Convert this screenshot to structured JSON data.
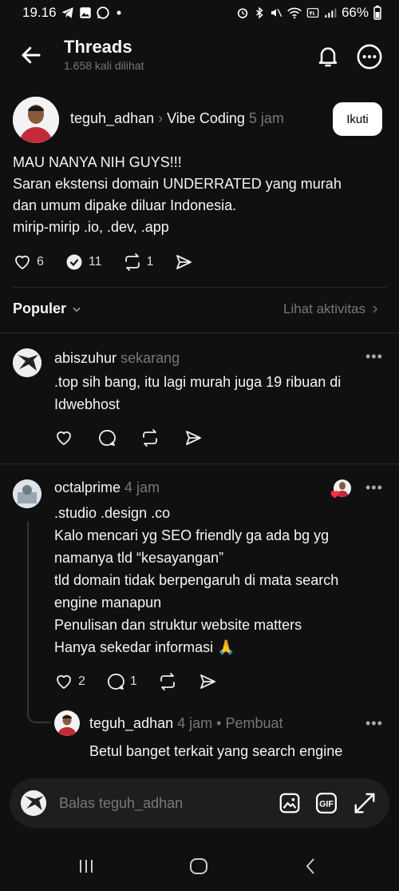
{
  "status": {
    "time": "19.16",
    "battery": "66%"
  },
  "header": {
    "title": "Threads",
    "views": "1.658 kali dilihat"
  },
  "post": {
    "author": "teguh_adhan",
    "topic": "Vibe Coding",
    "time": "5 jam",
    "follow_label": "Ikuti",
    "lines": [
      "MAU NANYA NIH GUYS!!!",
      "Saran ekstensi domain UNDERRATED yang murah",
      "dan umum dipake diluar Indonesia.",
      "mirip-mirip .io, .dev, .app"
    ],
    "likes": "6",
    "replies": "11",
    "reposts": "1"
  },
  "sort": {
    "label": "Populer",
    "activity": "Lihat aktivitas"
  },
  "comments": [
    {
      "author": "abiszuhur",
      "time": "sekarang",
      "lines": [
        ".top sih bang, itu lagi murah juga 19 ribuan di",
        "Idwebhost"
      ]
    },
    {
      "author": "octalprime",
      "time": "4 jam",
      "lines": [
        ".studio .design .co",
        "Kalo mencari yg SEO friendly ga ada bg yg",
        "namanya tld “kesayangan”",
        "tld domain tidak berpengaruh di mata search",
        "engine manapun",
        "Penulisan dan struktur website matters",
        "Hanya sekedar informasi 🙏"
      ],
      "likes": "2",
      "replies": "1"
    },
    {
      "author": "teguh_adhan",
      "time": "4 jam",
      "creator_badge": "• Pembuat",
      "lines": [
        "Betul banget terkait yang search engine"
      ]
    }
  ],
  "reply_box": {
    "placeholder": "Balas teguh_adhan"
  },
  "icons": {
    "back": "back-arrow-icon",
    "bell": "bell-icon",
    "more": "more-circle-icon",
    "like": "heart-icon",
    "reply": "comment-icon",
    "repost": "repost-icon",
    "share": "send-icon",
    "image": "image-icon",
    "gif": "gif-icon",
    "expand": "expand-icon"
  },
  "colors": {
    "background": "#101010",
    "text": "#f3f5f7",
    "muted": "#777777",
    "like_red": "#ff3040"
  }
}
